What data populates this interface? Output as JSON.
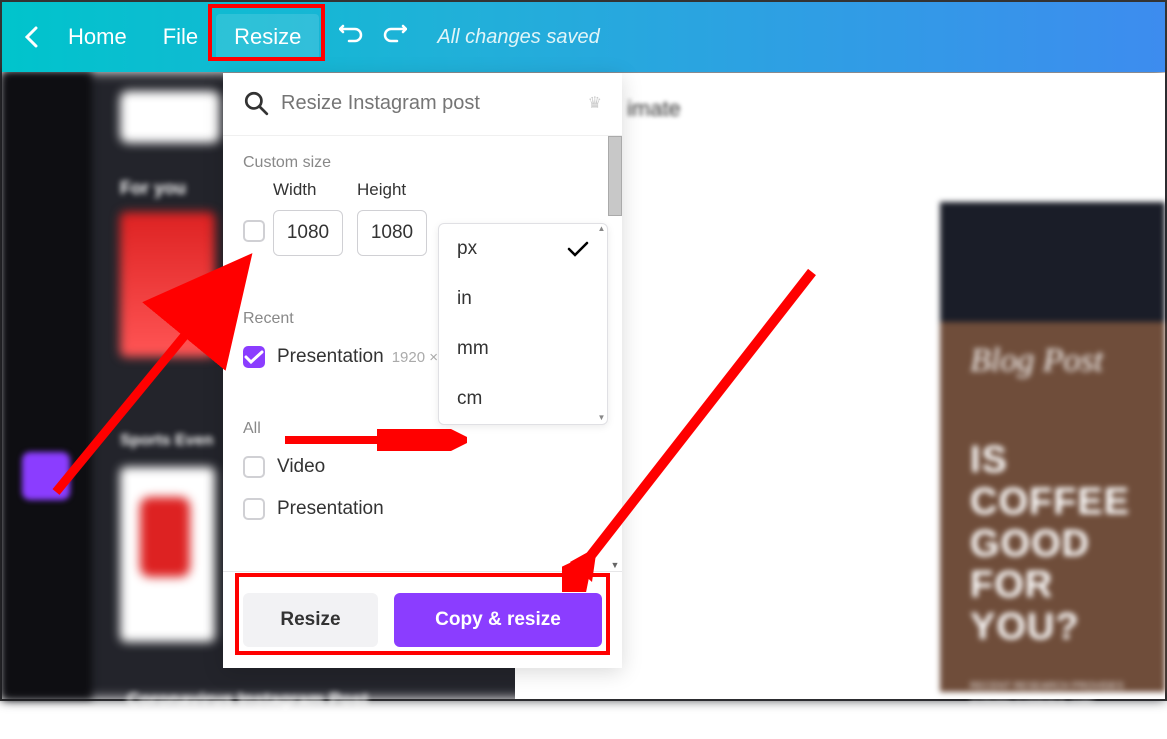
{
  "topbar": {
    "home": "Home",
    "file": "File",
    "resize": "Resize",
    "status": "All changes saved"
  },
  "doc_title": "imate",
  "panel": {
    "search_placeholder": "Resize Instagram post",
    "custom_size_label": "Custom size",
    "width_label": "Width",
    "height_label": "Height",
    "width_value": "1080",
    "height_value": "1080",
    "recent_label": "Recent",
    "recent_item": "Presentation",
    "recent_dims": "1920 ×",
    "all_label": "All",
    "all_items": [
      "Video",
      "Presentation"
    ],
    "units": [
      "px",
      "in",
      "mm",
      "cm"
    ],
    "resize_btn": "Resize",
    "copy_btn": "Copy & resize"
  },
  "bg": {
    "for_you": "For you",
    "sports": "Sports Even",
    "caption": "Coronavirus Instagram Post"
  },
  "preview": {
    "script": "Blog Post",
    "heading": "IS COFFEE GOOD FOR YOU?",
    "body": "RECENT RESEARCH PROVIDES STRONG EVIDENCE THAT COFFEE ACTUALLY HAS A LOT OF HEALTH BENEFITS"
  }
}
